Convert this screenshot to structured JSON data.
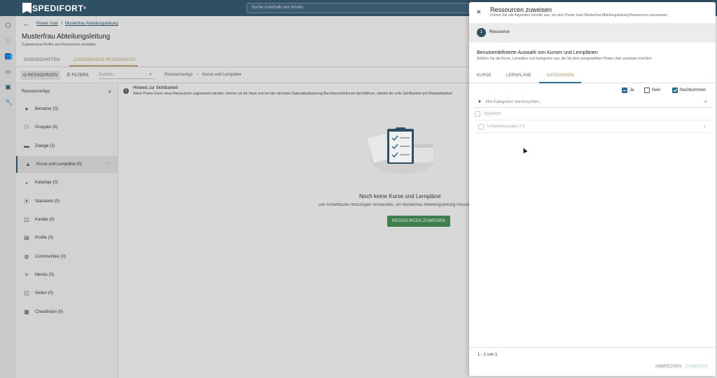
{
  "topbar": {
    "logo": "SPEDIFORT",
    "logo_mark": "®",
    "search_placeholder": "Suche innerhalb des Inhalts"
  },
  "rail": {
    "icons": [
      "cube-icon",
      "heart-icon",
      "users-icon",
      "folder-icon",
      "chart-icon",
      "wrench-icon"
    ]
  },
  "breadcrumb": {
    "items": [
      "Power User",
      "Musterfrau Abteilungsleitung"
    ],
    "separator": "/"
  },
  "page": {
    "title": "Musterfrau Abteilungsleitung",
    "subtitle": "Zugewiesene Profile und Ressourcen verwalten"
  },
  "tabs": {
    "items": [
      "EIGENSCHAFTEN",
      "ZUGEWIESENE RESSOURCEN"
    ],
    "active": "ZUGEWIESENE RESSOURCEN"
  },
  "toolbar": {
    "resources_label": "RESSOURCEN",
    "filters_label": "FILTERS",
    "search_placeholder": "Suchen...",
    "crumbs": [
      "Ressourcentyp",
      "›",
      "Kurse und Lernpläne"
    ]
  },
  "resource_sidebar": {
    "heading": "Ressourcentyp",
    "items": [
      {
        "label": "Benutzer (0)",
        "icon": "user-icon"
      },
      {
        "label": "Gruppen (0)",
        "icon": "group-icon"
      },
      {
        "label": "Zweige (2)",
        "icon": "folder-icon"
      },
      {
        "label": "Kurse und Lernpläne (0)",
        "icon": "graduation-icon"
      },
      {
        "label": "Kataloge (0)",
        "icon": "catalog-icon"
      },
      {
        "label": "Standorte (0)",
        "icon": "location-icon"
      },
      {
        "label": "Kanäle (0)",
        "icon": "channel-icon"
      },
      {
        "label": "Profile (0)",
        "icon": "profile-icon"
      },
      {
        "label": "Communities (0)",
        "icon": "globe-icon"
      },
      {
        "label": "Menüs (0)",
        "icon": "menu-icon"
      },
      {
        "label": "Seiten (0)",
        "icon": "pages-icon"
      },
      {
        "label": "Checklisten (0)",
        "icon": "checklist-icon"
      }
    ],
    "active_index": 3
  },
  "hint": {
    "title": "Hinweis zur Sichtbarkeit",
    "text": "Wenn Power Usern neue Ressourcen zugewiesen werden, können sie für diese erst bei der nächsten Datenaktualisierung Berichtsrestriktionen durchführen, obwohl die volle Sichtbarkeit und Bearbeitbarkeit"
  },
  "empty_state": {
    "title": "Noch keine Kurse und Lernpläne",
    "subtitle": "Die Schaltfläche Hinzufügen verwenden, um Musterfrau Abteilungsleitung Ressourcen zuzuweisen",
    "button": "RESSOURCEN ZUWEISEN"
  },
  "drawer": {
    "title": "Ressourcen zuweisen",
    "subtitle": "Führen Sie alle folgenden Schritte aus, um dem Power User Musterfrau Abteilungsleitung Ressourcen zuzuweisen",
    "step_number": "1",
    "step_label": "Ressource",
    "selection_title": "Benutzerdefinierte Auswahl von Kursen und Lernplänen",
    "selection_subtitle": "Wählen Sie die Kurse, Lernpläne und Kategorien aus, die Sie dem ausgewählten Power User zuweisen möchten",
    "tabs": [
      "KURSE",
      "LERNPLÄNE",
      "KATEGORIEN"
    ],
    "active_tab": "KATEGORIEN",
    "filters": [
      {
        "label": "Ja",
        "state": "indeterminate"
      },
      {
        "label": "Nein",
        "state": "unchecked"
      },
      {
        "label": "Nachkommen",
        "state": "checked"
      }
    ],
    "category_search_placeholder": "Alle Kategorien durchsuchen...",
    "categories": [
      {
        "label": "Spedifort",
        "has_children": false
      },
      {
        "label": "Unterweisungen 2.0",
        "has_children": true
      }
    ],
    "pagination": "1 - 1 von 1",
    "cancel_label": "ABBRECHEN",
    "assign_label": "ZUWEISEN"
  },
  "colors": {
    "brand": "#2f4f63",
    "accent": "#a4935f",
    "primary_button": "#3f7e4d",
    "chevron": "#c9a227"
  }
}
